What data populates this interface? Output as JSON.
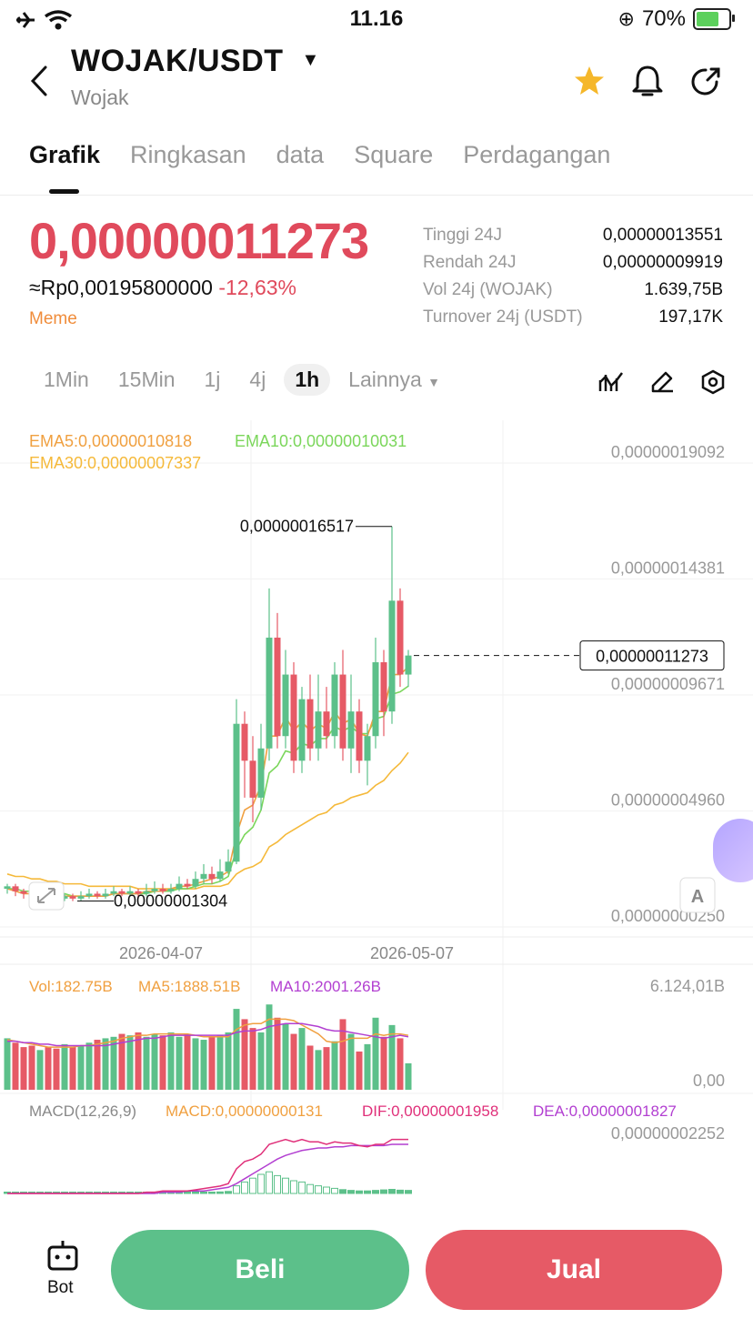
{
  "status_bar": {
    "time": "11.16",
    "battery": "70%",
    "battery_level": 0.7
  },
  "header": {
    "pair": "WOJAK/USDT",
    "name": "Wojak"
  },
  "tabs": [
    {
      "label": "Grafik",
      "active": true
    },
    {
      "label": "Ringkasan",
      "active": false
    },
    {
      "label": "data",
      "active": false
    },
    {
      "label": "Square",
      "active": false
    },
    {
      "label": "Perdagangan",
      "active": false
    }
  ],
  "price": {
    "last": "0,00000011273",
    "fiat": "≈Rp0,00195800000",
    "change": "-12,63%",
    "tag": "Meme",
    "stats": [
      {
        "label": "Tinggi 24J",
        "value": "0,00000013551"
      },
      {
        "label": "Rendah 24J",
        "value": "0,00000009919"
      },
      {
        "label": "Vol 24j (WOJAK)",
        "value": "1.639,75B"
      },
      {
        "label": "Turnover 24j (USDT)",
        "value": "197,17K"
      }
    ]
  },
  "intervals": [
    {
      "label": "1Min",
      "active": false
    },
    {
      "label": "15Min",
      "active": false
    },
    {
      "label": "1j",
      "active": false
    },
    {
      "label": "4j",
      "active": false
    },
    {
      "label": "1h",
      "active": true
    }
  ],
  "more_label": "Lainnya",
  "indicators": {
    "ema5": "EMA5:0,00000010818",
    "ema10": "EMA10:0,00000010031",
    "ema30": "EMA30:0,00000007337",
    "vol": "Vol:182.75B",
    "ma5": "MA5:1888.51B",
    "ma10": "MA10:2001.26B",
    "macd_title": "MACD(12,26,9)",
    "macd": "MACD:0,00000000131",
    "dif": "DIF:0,00000001958",
    "dea": "DEA:0,00000001827"
  },
  "colors": {
    "up": "#5cc08a",
    "down": "#e65a66",
    "ema5": "#f0a040",
    "ema10": "#7bd65b",
    "ema30": "#f5b93a",
    "ma10": "#b23fd1",
    "dif": "#e0307a"
  },
  "chart_data": {
    "type": "candlestick",
    "price_axis_labels": [
      "0,00000019092",
      "0,00000014381",
      "0,00000009671",
      "0,00000004960",
      "0,00000000250"
    ],
    "price_axis_values": [
      19.092,
      14.381,
      9.671,
      4.96,
      0.25
    ],
    "price_unit": "1e-8 USDT",
    "x_labels": [
      "2026-04-07",
      "2026-05-07"
    ],
    "last_price_label": "0,00000011273",
    "last_price_value": 11.273,
    "high_marker": {
      "label": "0,00000016517",
      "value": 16.517
    },
    "low_marker": {
      "label": "0,00000001304",
      "value": 1.304
    },
    "candles": [
      [
        1.8,
        1.9,
        1.6,
        2.0
      ],
      [
        1.9,
        1.7,
        1.5,
        2.0
      ],
      [
        1.7,
        1.6,
        1.4,
        1.8
      ],
      [
        1.6,
        1.5,
        1.3,
        1.7
      ],
      [
        1.5,
        1.6,
        1.3,
        1.7
      ],
      [
        1.6,
        1.5,
        1.3,
        1.7
      ],
      [
        1.5,
        1.4,
        1.3,
        1.6
      ],
      [
        1.4,
        1.5,
        1.3,
        1.6
      ],
      [
        1.5,
        1.4,
        1.3,
        1.6
      ],
      [
        1.4,
        1.5,
        1.3,
        1.7
      ],
      [
        1.5,
        1.6,
        1.4,
        1.8
      ],
      [
        1.6,
        1.5,
        1.4,
        1.7
      ],
      [
        1.5,
        1.6,
        1.4,
        1.8
      ],
      [
        1.6,
        1.7,
        1.5,
        1.9
      ],
      [
        1.7,
        1.6,
        1.5,
        1.8
      ],
      [
        1.6,
        1.7,
        1.5,
        1.9
      ],
      [
        1.7,
        1.6,
        1.4,
        1.8
      ],
      [
        1.6,
        1.7,
        1.5,
        2.0
      ],
      [
        1.7,
        1.8,
        1.6,
        2.1
      ],
      [
        1.8,
        1.7,
        1.6,
        2.0
      ],
      [
        1.7,
        1.8,
        1.6,
        2.0
      ],
      [
        1.8,
        2.0,
        1.7,
        2.3
      ],
      [
        2.0,
        1.9,
        1.8,
        2.2
      ],
      [
        1.9,
        2.2,
        1.8,
        2.5
      ],
      [
        2.2,
        2.4,
        2.0,
        2.8
      ],
      [
        2.4,
        2.2,
        2.0,
        2.7
      ],
      [
        2.2,
        2.5,
        2.1,
        3.0
      ],
      [
        2.5,
        2.9,
        2.4,
        3.4
      ],
      [
        2.9,
        8.5,
        2.8,
        9.5
      ],
      [
        8.5,
        7.0,
        5.5,
        9.0
      ],
      [
        7.0,
        5.5,
        4.5,
        8.0
      ],
      [
        5.5,
        7.5,
        5.0,
        8.5
      ],
      [
        7.5,
        12.0,
        7.0,
        14.0
      ],
      [
        12.0,
        8.0,
        7.5,
        13.0
      ],
      [
        8.0,
        10.5,
        7.5,
        11.5
      ],
      [
        10.5,
        7.0,
        6.5,
        11.0
      ],
      [
        7.0,
        9.5,
        6.5,
        10.0
      ],
      [
        9.5,
        7.5,
        7.0,
        10.5
      ],
      [
        7.5,
        9.0,
        7.0,
        10.5
      ],
      [
        9.0,
        8.0,
        7.5,
        10.0
      ],
      [
        8.0,
        10.5,
        7.5,
        11.0
      ],
      [
        10.5,
        7.5,
        7.0,
        11.5
      ],
      [
        7.5,
        9.0,
        6.5,
        10.5
      ],
      [
        9.0,
        7.0,
        6.5,
        9.5
      ],
      [
        7.0,
        8.0,
        6.0,
        8.5
      ],
      [
        8.0,
        11.0,
        7.5,
        12.0
      ],
      [
        11.0,
        9.0,
        8.0,
        11.5
      ],
      [
        9.0,
        13.5,
        8.5,
        16.517
      ],
      [
        13.5,
        10.5,
        10.0,
        14.0
      ],
      [
        10.5,
        11.273,
        10.0,
        11.5
      ]
    ],
    "ema5": [
      1.8,
      1.7,
      1.6,
      1.6,
      1.5,
      1.5,
      1.5,
      1.5,
      1.5,
      1.5,
      1.5,
      1.5,
      1.5,
      1.6,
      1.6,
      1.6,
      1.6,
      1.7,
      1.7,
      1.7,
      1.8,
      1.9,
      1.9,
      2.0,
      2.1,
      2.2,
      2.3,
      2.5,
      4.0,
      5.0,
      5.2,
      6.0,
      8.0,
      8.0,
      8.8,
      8.2,
      8.6,
      8.2,
      8.5,
      8.3,
      9.0,
      8.5,
      8.7,
      8.1,
      8.0,
      9.0,
      9.0,
      10.5,
      10.5,
      10.818
    ],
    "ema10": [
      1.8,
      1.8,
      1.7,
      1.7,
      1.6,
      1.6,
      1.6,
      1.6,
      1.5,
      1.5,
      1.5,
      1.5,
      1.5,
      1.6,
      1.6,
      1.6,
      1.6,
      1.6,
      1.7,
      1.7,
      1.7,
      1.8,
      1.8,
      1.9,
      2.0,
      2.0,
      2.1,
      2.3,
      3.4,
      4.0,
      4.3,
      5.0,
      6.5,
      6.8,
      7.4,
      7.3,
      7.7,
      7.6,
      7.9,
      7.9,
      8.4,
      8.2,
      8.4,
      8.1,
      8.1,
      8.7,
      8.8,
      9.7,
      9.8,
      10.031
    ],
    "ema30": [
      2.4,
      2.3,
      2.3,
      2.2,
      2.2,
      2.1,
      2.1,
      2.0,
      2.0,
      2.0,
      1.9,
      1.9,
      1.9,
      1.9,
      1.9,
      1.9,
      1.8,
      1.8,
      1.8,
      1.8,
      1.8,
      1.8,
      1.8,
      1.8,
      1.9,
      1.9,
      1.9,
      2.0,
      2.4,
      2.6,
      2.7,
      2.9,
      3.5,
      3.7,
      4.0,
      4.2,
      4.4,
      4.6,
      4.8,
      4.9,
      5.2,
      5.3,
      5.5,
      5.6,
      5.7,
      6.0,
      6.2,
      6.6,
      6.9,
      7.337
    ],
    "volume_axis_labels": [
      "6.124,01B",
      "0,00"
    ],
    "volume_axis_max": 6124.01,
    "volume": [
      3.5,
      3.2,
      2.9,
      3.0,
      2.7,
      2.9,
      2.8,
      3.1,
      2.9,
      3.0,
      3.2,
      3.4,
      3.5,
      3.6,
      3.8,
      3.7,
      3.9,
      3.6,
      3.8,
      3.7,
      3.9,
      3.6,
      3.8,
      3.5,
      3.4,
      3.6,
      3.7,
      3.9,
      5.5,
      4.8,
      4.2,
      3.9,
      5.8,
      4.9,
      4.5,
      3.8,
      4.2,
      3.0,
      2.7,
      2.9,
      3.3,
      4.8,
      3.8,
      2.6,
      3.1,
      4.9,
      3.6,
      4.4,
      3.5,
      1.8
    ],
    "volume_ma5": [
      3.4,
      3.3,
      3.2,
      3.1,
      3.0,
      2.9,
      2.9,
      2.9,
      2.9,
      3.0,
      3.0,
      3.1,
      3.2,
      3.3,
      3.5,
      3.6,
      3.7,
      3.7,
      3.8,
      3.8,
      3.8,
      3.8,
      3.8,
      3.7,
      3.6,
      3.6,
      3.6,
      3.6,
      4.1,
      4.4,
      4.5,
      4.5,
      4.8,
      4.8,
      4.8,
      4.7,
      4.4,
      4.1,
      3.8,
      3.3,
      3.2,
      3.3,
      3.5,
      3.5,
      3.5,
      3.8,
      3.7,
      3.8,
      3.8,
      3.7
    ],
    "volume_ma10": [
      3.3,
      3.3,
      3.2,
      3.2,
      3.1,
      3.1,
      3.0,
      3.0,
      3.0,
      3.0,
      3.0,
      3.0,
      3.0,
      3.1,
      3.2,
      3.3,
      3.4,
      3.5,
      3.5,
      3.6,
      3.7,
      3.7,
      3.7,
      3.7,
      3.7,
      3.7,
      3.7,
      3.7,
      3.9,
      4.0,
      4.0,
      4.1,
      4.3,
      4.4,
      4.5,
      4.5,
      4.5,
      4.4,
      4.3,
      4.1,
      4.0,
      4.0,
      3.9,
      3.8,
      3.7,
      3.6,
      3.5,
      3.6,
      3.7,
      3.6
    ],
    "macd_axis_label": "0,00000002252",
    "dif": [
      0,
      0,
      0,
      0,
      0,
      0,
      0,
      0,
      0,
      0,
      0,
      0,
      0,
      0,
      0,
      0,
      0,
      0.05,
      0.05,
      0.1,
      0.1,
      0.1,
      0.1,
      0.15,
      0.2,
      0.25,
      0.3,
      0.4,
      1.0,
      1.3,
      1.4,
      1.6,
      2.0,
      2.1,
      2.2,
      2.1,
      2.2,
      2.1,
      2.1,
      2.0,
      2.1,
      2.05,
      2.05,
      1.95,
      1.9,
      2.0,
      2.0,
      2.2,
      2.2,
      2.2
    ],
    "dea": [
      0,
      0,
      0,
      0,
      0,
      0,
      0,
      0,
      0,
      0,
      0,
      0,
      0,
      0,
      0,
      0,
      0,
      0,
      0,
      0.05,
      0.05,
      0.05,
      0.1,
      0.1,
      0.1,
      0.15,
      0.2,
      0.25,
      0.4,
      0.6,
      0.8,
      1.0,
      1.2,
      1.4,
      1.55,
      1.65,
      1.75,
      1.8,
      1.85,
      1.85,
      1.9,
      1.9,
      1.95,
      1.95,
      1.95,
      1.95,
      1.95,
      2.0,
      2.0,
      2.0
    ],
    "macd_hist": [
      0.04,
      0.04,
      0.03,
      0.03,
      0.03,
      0.03,
      0.03,
      0.03,
      0.03,
      0.03,
      0.03,
      0.03,
      0.03,
      0.03,
      0.03,
      0.03,
      0.03,
      0.03,
      0.04,
      0.04,
      0.04,
      0.04,
      0.04,
      0.04,
      0.05,
      0.05,
      0.06,
      0.08,
      0.3,
      0.45,
      0.6,
      0.75,
      0.85,
      0.7,
      0.6,
      0.5,
      0.45,
      0.35,
      0.3,
      0.25,
      0.2,
      0.15,
      0.12,
      0.1,
      0.1,
      0.12,
      0.14,
      0.16,
      0.13,
      0.12
    ]
  },
  "buttons": {
    "bot": "Bot",
    "buy": "Beli",
    "sell": "Jual"
  },
  "axis_button": "A"
}
